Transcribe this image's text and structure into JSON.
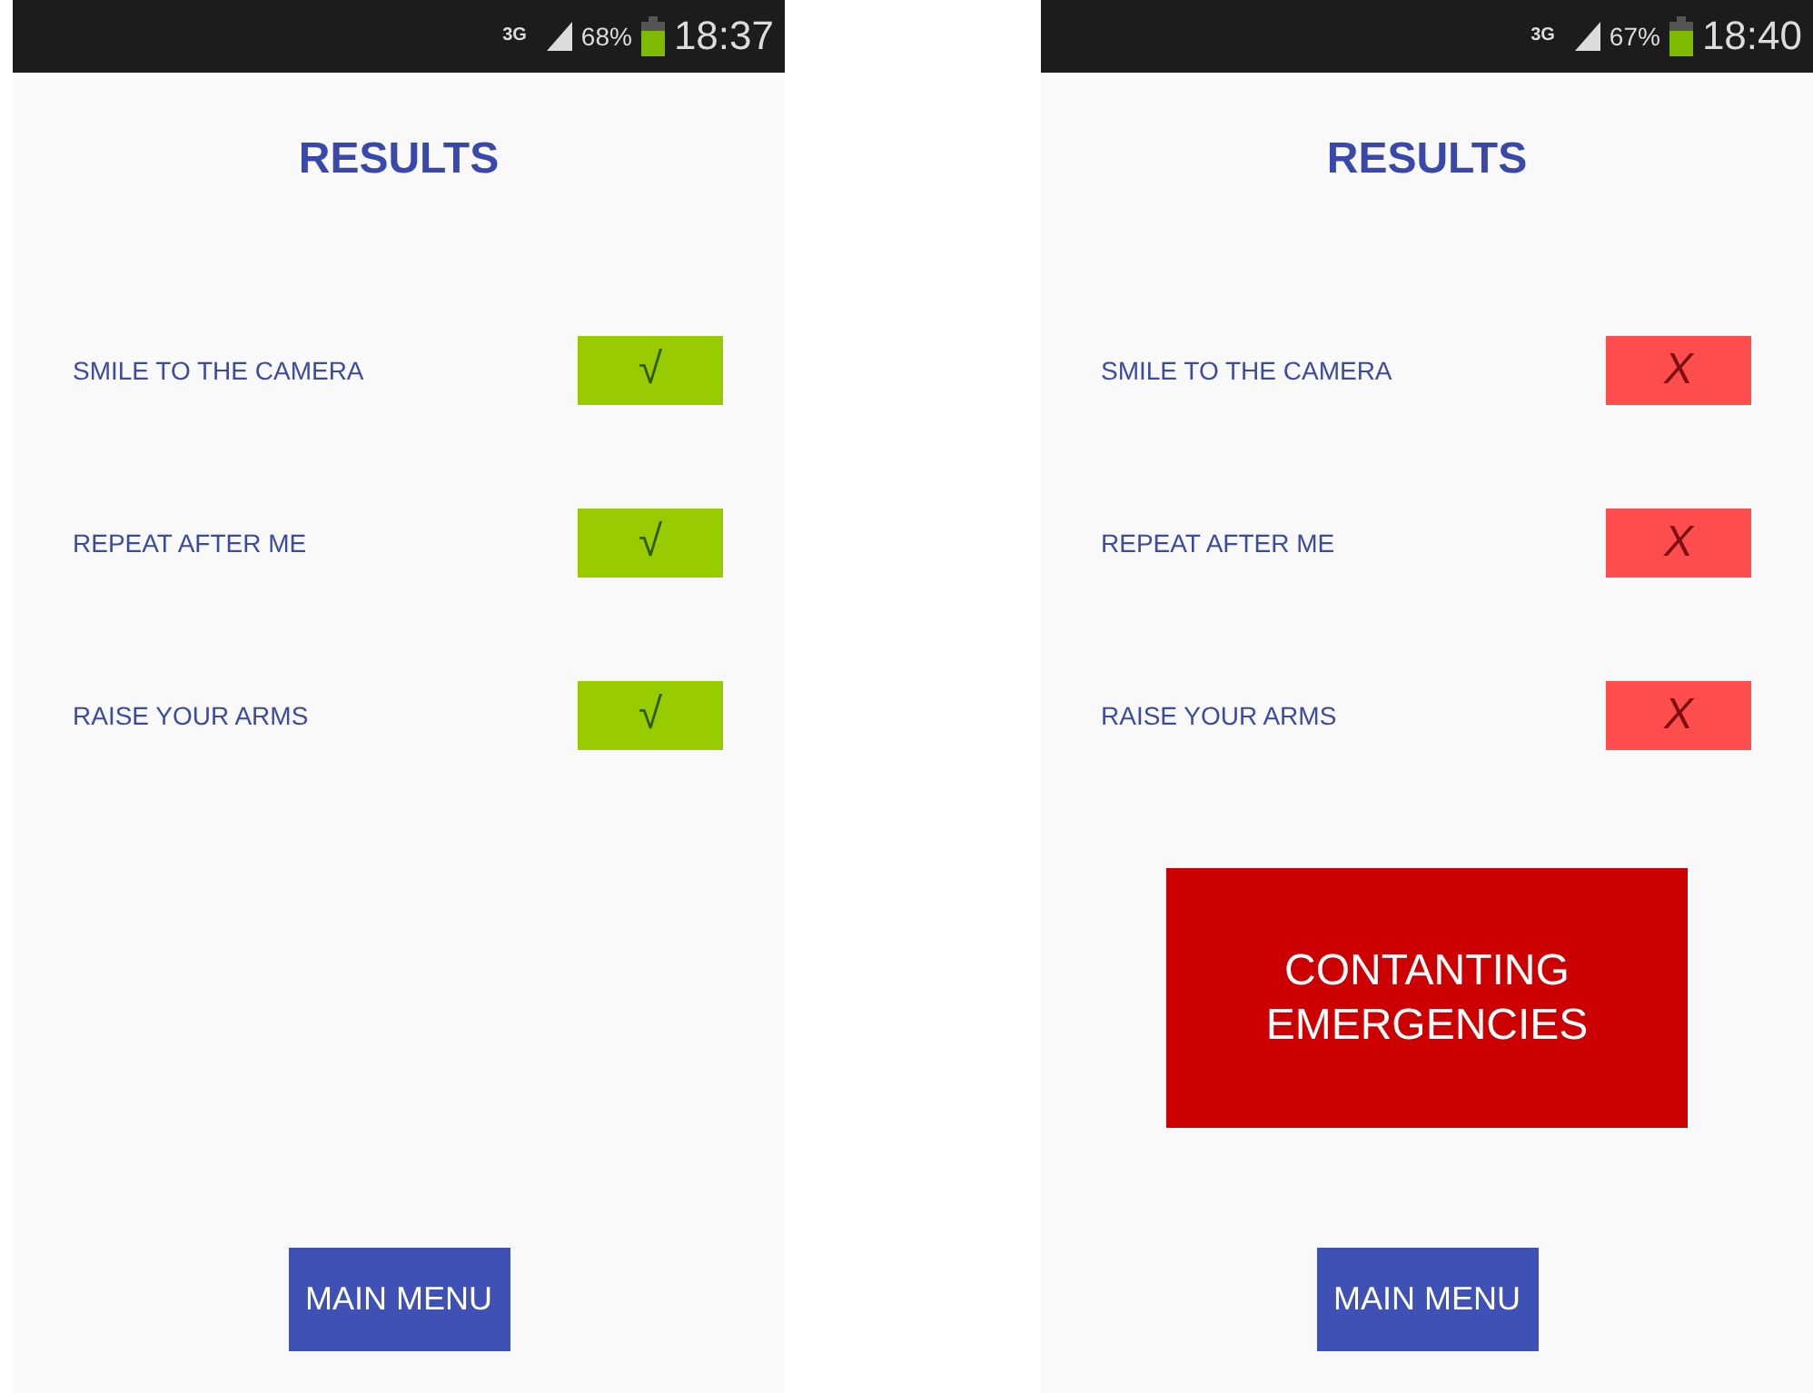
{
  "phones": [
    {
      "status_bar": {
        "network": "3G",
        "battery": "68%",
        "time": "18:37"
      },
      "title": "RESULTS",
      "results": [
        {
          "label": "SMILE TO THE CAMERA",
          "passed": true,
          "mark": "√"
        },
        {
          "label": "REPEAT AFTER ME",
          "passed": true,
          "mark": "√"
        },
        {
          "label": "RAISE YOUR ARMS",
          "passed": true,
          "mark": "√"
        }
      ],
      "main_menu_button": "MAIN MENU"
    },
    {
      "status_bar": {
        "network": "3G",
        "battery": "67%",
        "time": "18:40"
      },
      "title": "RESULTS",
      "results": [
        {
          "label": "SMILE TO THE CAMERA",
          "passed": false,
          "mark": "X"
        },
        {
          "label": "REPEAT AFTER ME",
          "passed": false,
          "mark": "X"
        },
        {
          "label": "RAISE YOUR ARMS",
          "passed": false,
          "mark": "X"
        }
      ],
      "emergency_button": "CONTANTING EMERGENCIES",
      "main_menu_button": "MAIN MENU"
    }
  ]
}
